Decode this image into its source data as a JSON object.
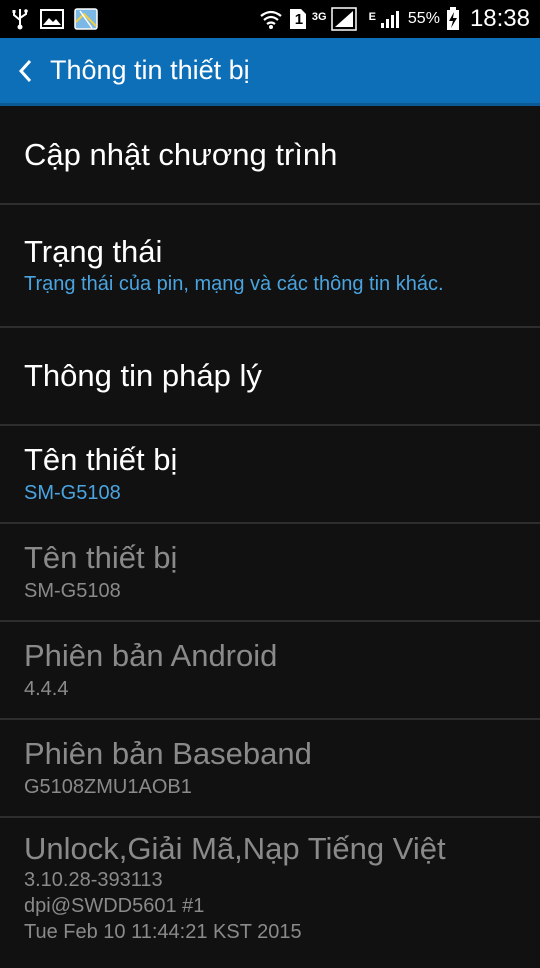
{
  "statusbar": {
    "network_3g": "3G",
    "network_e": "E",
    "sim_number": "1",
    "battery_percent": "55%",
    "time": "18:38"
  },
  "actionbar": {
    "title": "Thông tin thiết bị"
  },
  "items": [
    {
      "title": "Cập nhật chương trình",
      "enabled": true
    },
    {
      "title": "Trạng thái",
      "subtitle": "Trạng thái của pin, mạng và các thông tin khác.",
      "enabled": true
    },
    {
      "title": "Thông tin pháp lý",
      "enabled": true
    },
    {
      "title": "Tên thiết bị",
      "subtitle": "SM-G5108",
      "enabled": true
    },
    {
      "title": "Tên thiết bị",
      "subtitle": "SM-G5108",
      "enabled": false
    },
    {
      "title": "Phiên bản Android",
      "subtitle": "4.4.4",
      "enabled": false
    },
    {
      "title": "Phiên bản Baseband",
      "subtitle": "G5108ZMU1AOB1",
      "enabled": false
    },
    {
      "title": "Unlock,Giải Mã,Nạp Tiếng Việt",
      "subtitle_lines": [
        "3.10.28-393113",
        "dpi@SWDD5601 #1",
        "Tue Feb 10 11:44:21 KST 2015"
      ],
      "enabled": false
    }
  ],
  "colors": {
    "actionbar": "#0d6fb8",
    "accent_text": "#4aa4e0",
    "background": "#111111",
    "disabled_text": "#8a8a8a"
  }
}
